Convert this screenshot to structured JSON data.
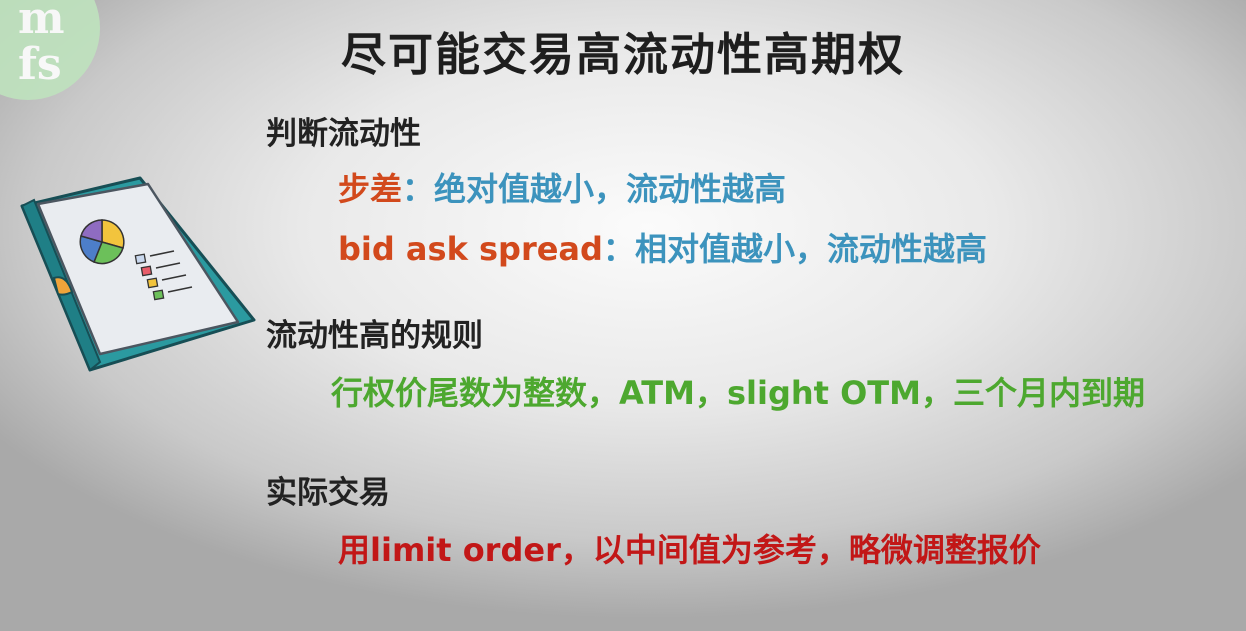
{
  "slide": {
    "title": "尽可能交易高流动性高期权",
    "section_liquidity": {
      "heading": "判断流动性",
      "tick": {
        "term": "步差",
        "separator": "：",
        "desc": "绝对值越小，流动性越高"
      },
      "spread": {
        "term": "bid ask spread",
        "separator": "：",
        "desc": "相对值越小，流动性越高"
      }
    },
    "section_rules": {
      "heading": "流动性高的规则",
      "text": "行权价尾数为整数，ATM，slight OTM，三个月内到期"
    },
    "section_trading": {
      "heading": "实际交易",
      "text": "用limit order，以中间值为参考，略微调整报价"
    }
  },
  "logo": {
    "mark_top": "m",
    "mark_bottom": "fs"
  },
  "colors": {
    "title": "#1e1e1e",
    "heading": "#222222",
    "term_red": "#d2491c",
    "desc_blue": "#3c93bd",
    "rule_green": "#4da82f",
    "trade_red": "#c21717",
    "logo_green": "#bfe3be"
  },
  "icons": {
    "binder": "binder-chart-icon"
  }
}
